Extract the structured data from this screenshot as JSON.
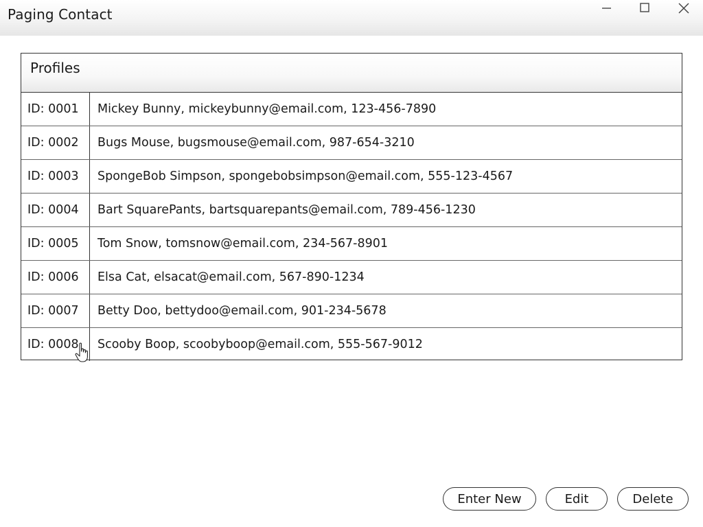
{
  "window": {
    "title": "Paging Contact"
  },
  "profiles": {
    "heading": "Profiles",
    "rows": [
      {
        "id": "ID: 0001",
        "info": "Mickey Bunny, mickeybunny@email.com, 123-456-7890"
      },
      {
        "id": "ID: 0002",
        "info": "Bugs Mouse, bugsmouse@email.com, 987-654-3210"
      },
      {
        "id": "ID: 0003",
        "info": "SpongeBob Simpson, spongebobsimpson@email.com, 555-123-4567"
      },
      {
        "id": "ID: 0004",
        "info": "Bart SquarePants, bartsquarepants@email.com, 789-456-1230"
      },
      {
        "id": "ID: 0005",
        "info": "Tom Snow, tomsnow@email.com, 234-567-8901"
      },
      {
        "id": "ID: 0006",
        "info": "Elsa Cat, elsacat@email.com, 567-890-1234"
      },
      {
        "id": "ID: 0007",
        "info": "Betty Doo, bettydoo@email.com, 901-234-5678"
      },
      {
        "id": "ID: 0008",
        "info": "Scooby Boop, scoobyboop@email.com, 555-567-9012"
      }
    ]
  },
  "actions": {
    "enter_new": "Enter New",
    "edit": "Edit",
    "delete": "Delete"
  },
  "icons": {
    "minimize": "minimize-icon",
    "maximize": "maximize-icon",
    "close": "close-icon",
    "cursor": "hand-pointer-icon"
  }
}
